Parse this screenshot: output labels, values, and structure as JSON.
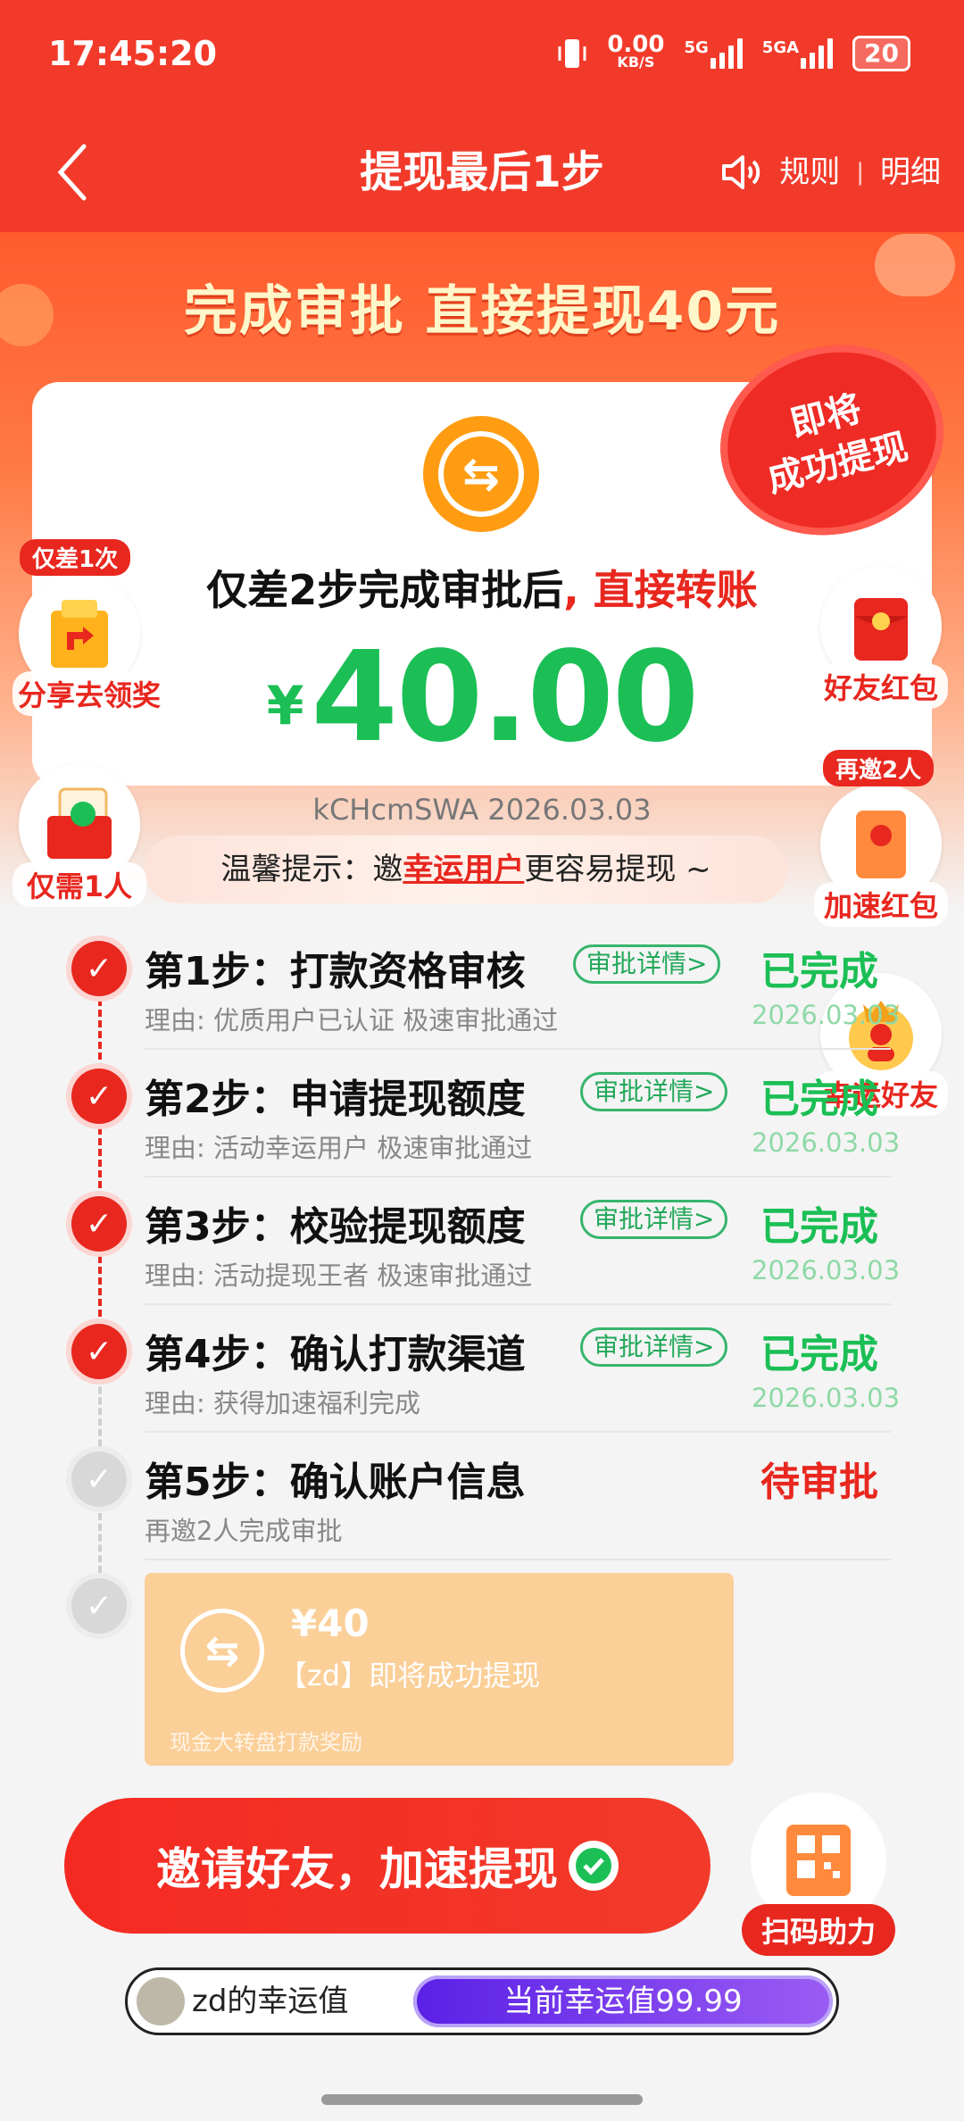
{
  "status_bar": {
    "time": "17:45:20",
    "net_speed": "0.00",
    "net_unit": "KB/S",
    "sig1": "5G",
    "sig2": "5GA",
    "battery": "20"
  },
  "nav": {
    "title": "提现最后1步",
    "rules": "规则",
    "divider": "|",
    "details": "明细"
  },
  "hero": {
    "headline": "完成审批 直接提现40元",
    "stamp_line1": "即将",
    "stamp_line2": "成功提现"
  },
  "card": {
    "text_main": "仅差2步完成审批后",
    "text_red": ", 直接转账",
    "currency": "¥",
    "amount": "40.00",
    "meta": "kCHcmSWA 2026.03.03"
  },
  "tip": {
    "prefix": "温馨提示：邀",
    "highlight": "幸运用户",
    "suffix": "更容易提现 ~"
  },
  "floats": {
    "share": {
      "badge": "仅差1次",
      "label": "分享去领奖"
    },
    "friend_redpack": {
      "label": "好友红包"
    },
    "one_person": {
      "label": "仅需1人"
    },
    "speed_redpack": {
      "badge": "再邀2人",
      "label": "加速红包"
    },
    "lucky_friend": {
      "label": "幸运好友"
    }
  },
  "steps": [
    {
      "title": "第1步：打款资格审核",
      "detail": "审批详情>",
      "status": "已完成",
      "reason": "理由: 优质用户已认证 极速审批通过",
      "date": "2026.03.03"
    },
    {
      "title": "第2步：申请提现额度",
      "detail": "审批详情>",
      "status": "已完成",
      "reason": "理由: 活动幸运用户 极速审批通过",
      "date": "2026.03.03"
    },
    {
      "title": "第3步：校验提现额度",
      "detail": "审批详情>",
      "status": "已完成",
      "reason": "理由: 活动提现王者 极速审批通过",
      "date": "2026.03.03"
    },
    {
      "title": "第4步：确认打款渠道",
      "detail": "审批详情>",
      "status": "已完成",
      "reason": "理由: 获得加速福利完成",
      "date": "2026.03.03"
    },
    {
      "title": "第5步：确认账户信息",
      "status": "待审批",
      "reason": "再邀2人完成审批"
    }
  ],
  "payout": {
    "amount": "¥40",
    "desc": "【zd】即将成功提现",
    "source": "现金大转盘打款奖励"
  },
  "actions": {
    "invite": "邀请好友，加速提现",
    "scan": "扫码助力"
  },
  "lucky": {
    "name": "zd的幸运值",
    "value": "当前幸运值99.99"
  },
  "colors": {
    "brand_red": "#f23a2a",
    "success_green": "#1bbf55",
    "accent_orange": "#ff9c12",
    "lucky_purple": "#5a20e6"
  }
}
